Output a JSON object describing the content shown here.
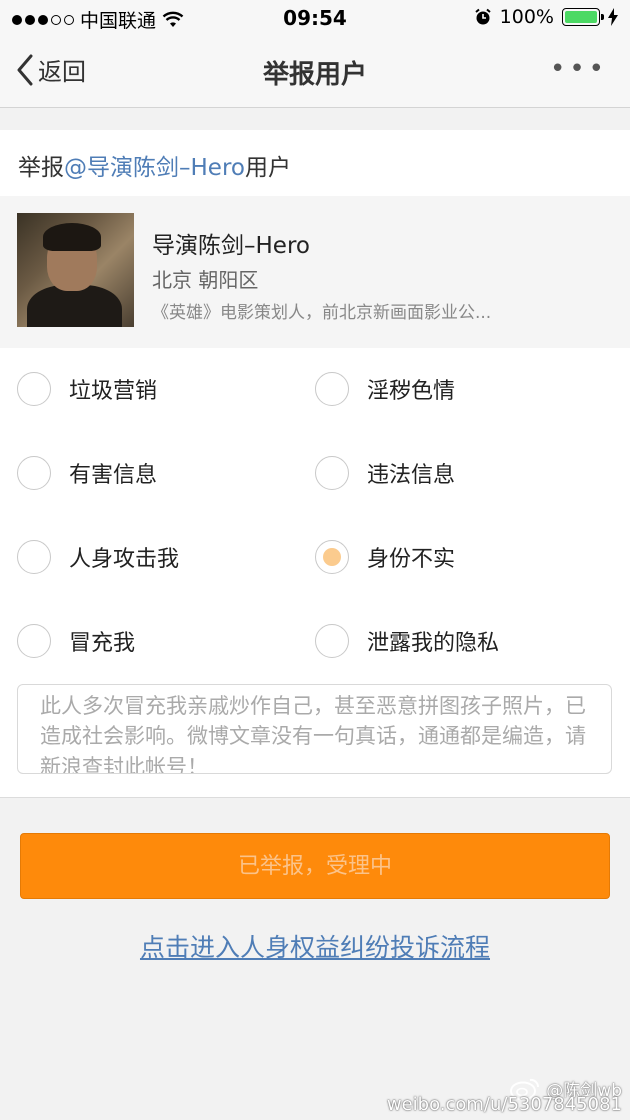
{
  "status": {
    "carrier": "中国联通",
    "time": "09:54",
    "battery": "100%"
  },
  "nav": {
    "back_label": "返回",
    "title": "举报用户",
    "more": "•••"
  },
  "report": {
    "prefix": "举报",
    "mention": "@导演陈剑–Hero",
    "suffix": "用户"
  },
  "profile": {
    "name": "导演陈剑–Hero",
    "location": "北京 朝阳区",
    "description": "《英雄》电影策划人，前北京新画面影业公..."
  },
  "options": [
    {
      "label": "垃圾营销",
      "checked": false
    },
    {
      "label": "淫秽色情",
      "checked": false
    },
    {
      "label": "有害信息",
      "checked": false
    },
    {
      "label": "违法信息",
      "checked": false
    },
    {
      "label": "人身攻击我",
      "checked": false
    },
    {
      "label": "身份不实",
      "checked": true
    },
    {
      "label": "冒充我",
      "checked": false
    },
    {
      "label": "泄露我的隐私",
      "checked": false
    }
  ],
  "reason_text": "此人多次冒充我亲戚炒作自己，甚至恶意拼图孩子照片，已造成社会影响。微博文章没有一句真话，通通都是编造，请新浪查封此帐号！",
  "submit_label": "已举报，受理中",
  "complaint_link": "点击进入人身权益纠纷投诉流程",
  "watermark": {
    "handle": "@陈剑wb",
    "url": "weibo.com/u/5307845081"
  },
  "colors": {
    "accent_orange": "#fe8a0b",
    "link_blue": "#4f7db6",
    "radio_checked": "#fbcb8e",
    "battery_green": "#4cd964"
  }
}
